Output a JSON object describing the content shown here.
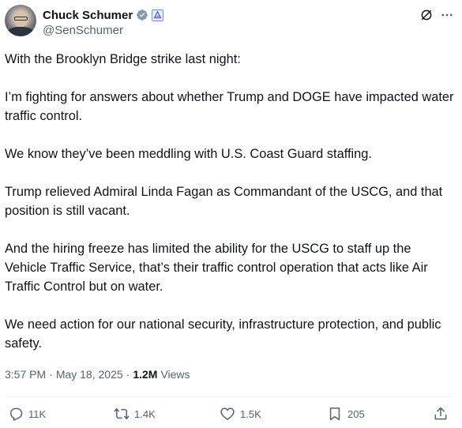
{
  "author": {
    "name": "Chuck Schumer",
    "handle": "@SenSchumer"
  },
  "tweet": {
    "paragraphs": [
      "With the Brooklyn Bridge strike last night:",
      "I’m fighting for answers about whether Trump and DOGE have impacted water traffic control.",
      "We know they’ve been meddling with U.S. Coast Guard staffing.",
      "Trump relieved Admiral Linda Fagan as Commandant of the USCG, and that position is still vacant.",
      "And the hiring freeze has limited the ability for the USCG to staff up the Vehicle Traffic Service, that’s their traffic control operation that acts like Air Traffic Control but on water.",
      "We need action for our national security, infrastructure protection, and public safety."
    ],
    "time": "3:57 PM",
    "date": "May 18, 2025",
    "views_count": "1.2M",
    "views_label": "Views"
  },
  "actions": {
    "replies": "11K",
    "reposts": "1.4K",
    "likes": "1.5K",
    "bookmarks": "205"
  },
  "colors": {
    "verified": "#829aab",
    "text_secondary": "#536471",
    "text_primary": "#0f1419"
  },
  "icons": {
    "verified": "verified-badge-icon",
    "government": "government-affiliation-icon",
    "grok": "grok-icon",
    "reply": "reply-icon",
    "repost": "repost-icon",
    "like": "like-icon",
    "bookmark": "bookmark-icon",
    "share": "share-icon"
  }
}
